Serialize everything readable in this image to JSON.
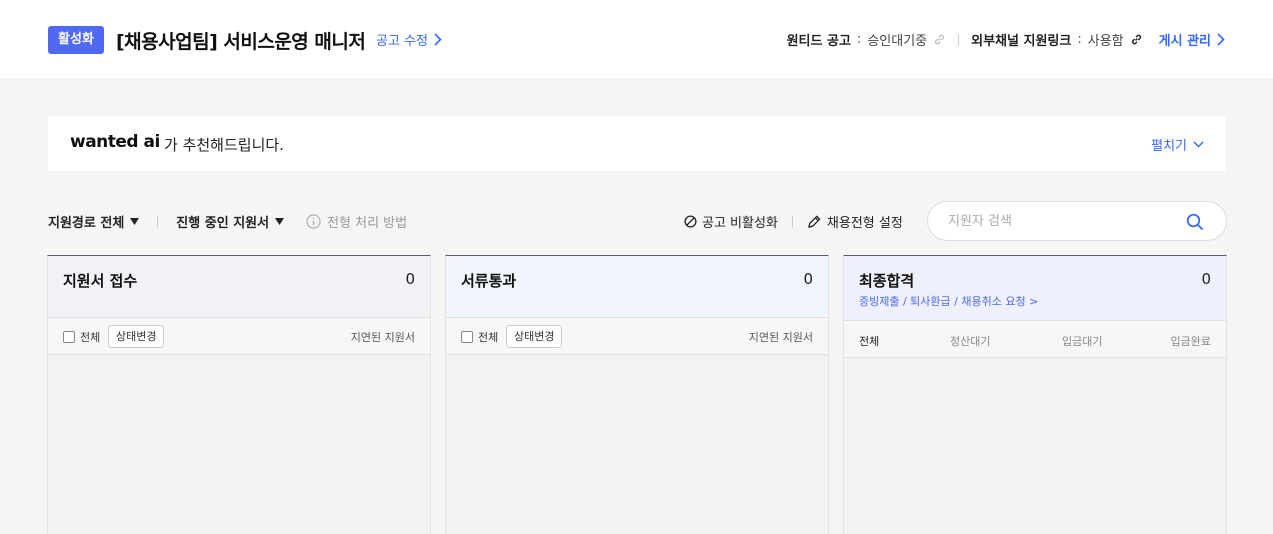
{
  "header": {
    "badge": "활성화",
    "title": "[채용사업팀] 서비스운영 매니저",
    "edit_link": "공고 수정",
    "wanted_post_label": "원티드 공고",
    "wanted_post_value": "승인대기중",
    "external_link_label": "외부채널 지원링크",
    "external_link_value": "사용함",
    "manage_link": "게시 관리"
  },
  "ai_banner": {
    "logo": "wanted ai",
    "text": "가 추천해드립니다.",
    "expand": "펼치기"
  },
  "filters": {
    "source": "지원경로 전체",
    "status": "진행 중인 지원서",
    "help": "전형 처리 방법"
  },
  "actions": {
    "deactivate": "공고 비활성화",
    "settings": "채용전형 설정"
  },
  "search": {
    "placeholder": "지원자 검색"
  },
  "columns": [
    {
      "title": "지원서 접수",
      "count": "0",
      "all": "전체",
      "status_button": "상태변경",
      "delayed": "지연된 지원서"
    },
    {
      "title": "서류통과",
      "count": "0",
      "all": "전체",
      "status_button": "상태변경",
      "delayed": "지연된 지원서"
    },
    {
      "title": "최종합격",
      "count": "0",
      "subtitle": "증빙제출 / 퇴사환급 / 채용취소 요청 >",
      "tabs": [
        "전체",
        "정산대기",
        "입금대기",
        "입금완료"
      ]
    }
  ],
  "colors": {
    "accent": "#3366ff",
    "badge": "#4f69f5",
    "col2_head": "#f1f6fc",
    "col1_head": "#f1f2f6",
    "col3_head": "#eef0fb"
  }
}
